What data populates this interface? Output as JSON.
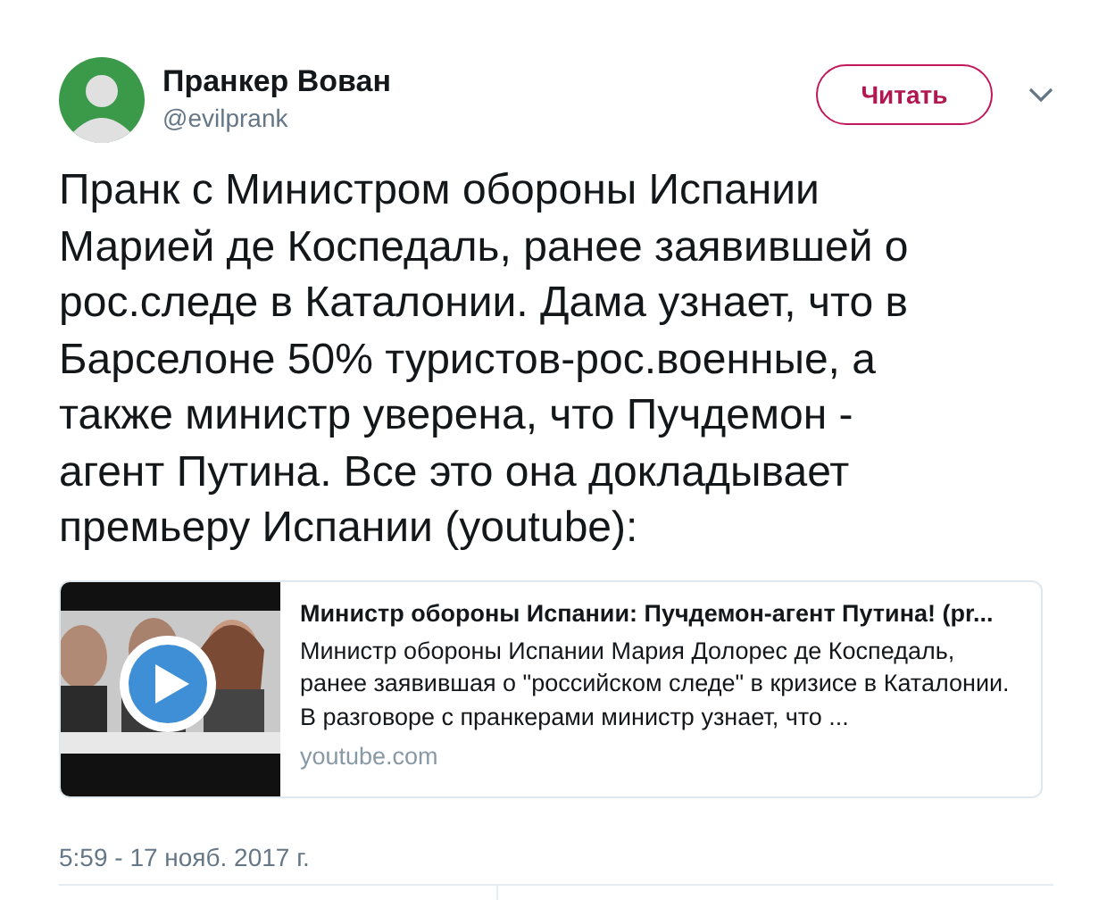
{
  "author": {
    "name": "Пранкер Вован",
    "handle": "@evilprank"
  },
  "follow_button": {
    "label": "Читать"
  },
  "tweet_text": "Пранк с Министром обороны Испании\nМарией де Коспедаль, ранее заявившей о\nрос.следе в Каталонии. Дама узнает, что в\nБарселоне 50% туристов-рос.военные, а\nтакже министр уверена, что Пучдемон -\nагент Путина. Все это она докладывает\nпремьеру Испании (youtube):",
  "link_card": {
    "title": "Министр обороны Испании: Пучдемон-агент Путина! (pr...",
    "description": "Министр обороны Испании Мария Долорес де Коспедаль, ранее заявившая о \"российском следе\" в кризисе в Каталонии. В разговоре с пранкерами министр узнает, что ...",
    "domain": "youtube.com"
  },
  "timestamp": "5:59 - 17 нояб. 2017 г."
}
